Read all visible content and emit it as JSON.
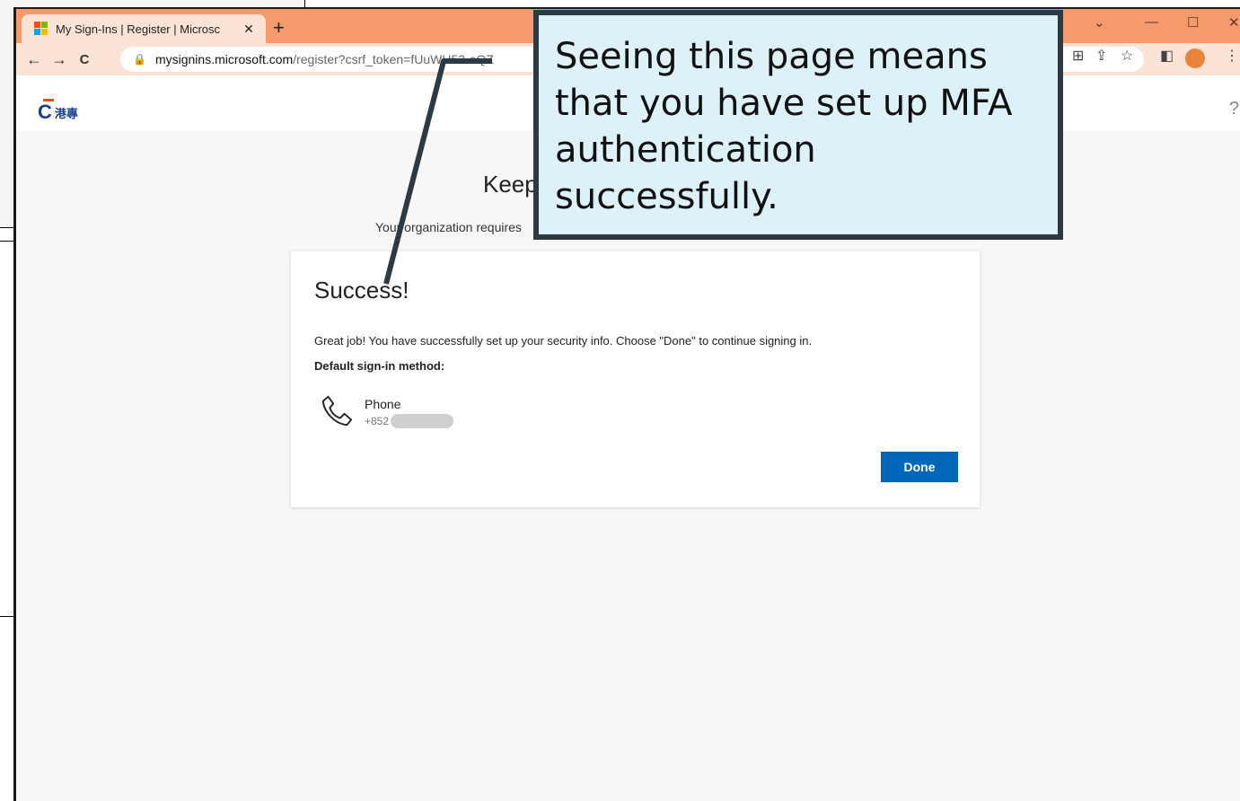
{
  "browser": {
    "tab_title": "My Sign-Ins | Register | Microsc",
    "tab_close": "✕",
    "new_tab": "+",
    "url_host": "mysignins.microsoft.com",
    "url_path": "/register?csrf_token=fUuWH53-oQZ",
    "back": "←",
    "forward": "→",
    "reload": "C"
  },
  "app": {
    "logo_text": "港專",
    "help": "?"
  },
  "page": {
    "heading": "Keep",
    "subheading": "Your organization requires"
  },
  "card": {
    "title": "Success!",
    "message": "Great job! You have successfully set up your security info. Choose \"Done\" to continue signing in.",
    "default_method_label": "Default sign-in method:",
    "method_title": "Phone",
    "method_number": "+852",
    "done_label": "Done"
  },
  "callout": {
    "text": "Seeing this page means that you have set up MFA authentication successfully."
  },
  "colors": {
    "titlebar": "#f49a6b",
    "done_button": "#0067b8",
    "callout_bg": "#ddf1f9"
  }
}
